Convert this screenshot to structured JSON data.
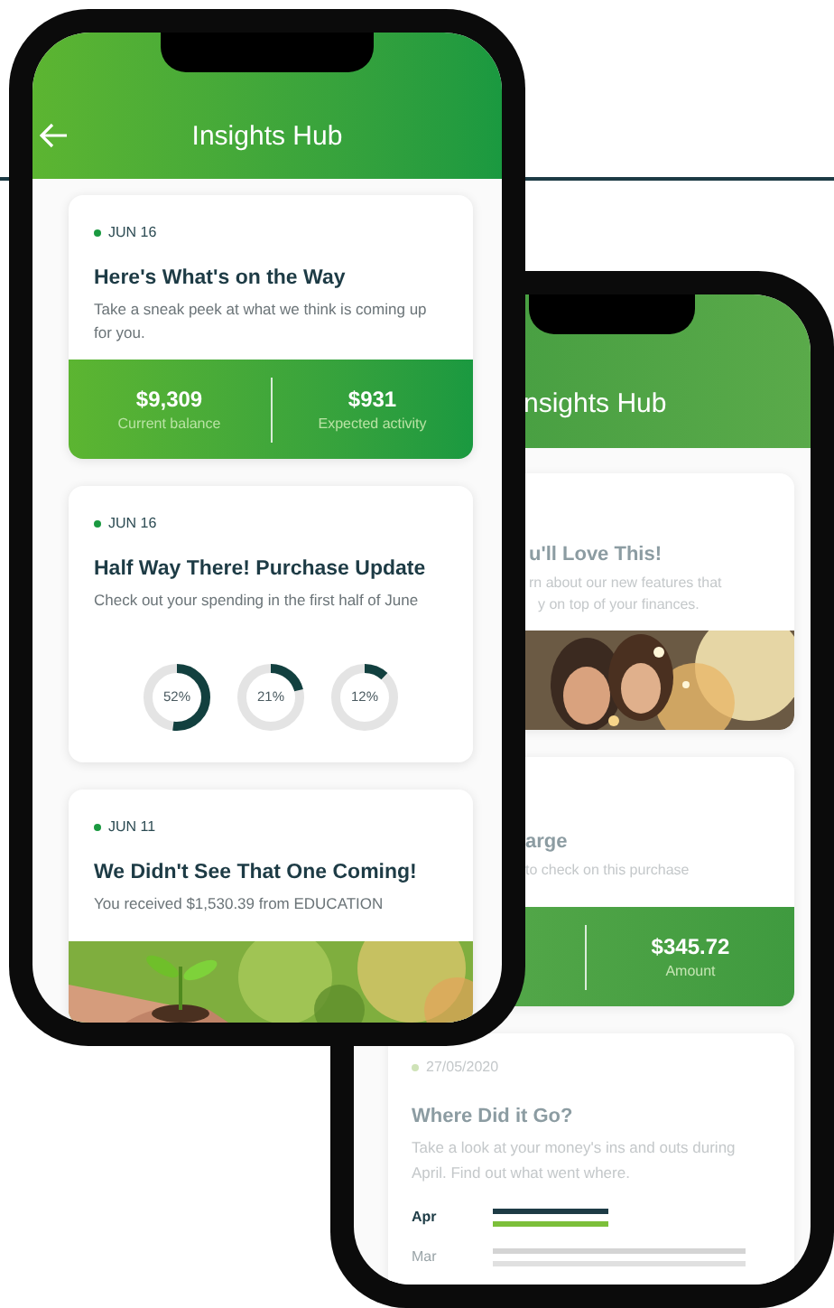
{
  "front_phone": {
    "header": {
      "title": "Insights Hub"
    },
    "cards": [
      {
        "kind": "summary",
        "date": "JUN 16",
        "title": "Here's What's on the Way",
        "description": "Take a sneak peek at what we think is coming up for you.",
        "stats": [
          {
            "value": "$9,309",
            "label": "Current balance"
          },
          {
            "value": "$931",
            "label": "Expected activity"
          }
        ]
      },
      {
        "kind": "rings",
        "date": "JUN 16",
        "title": "Half Way There! Purchase Update",
        "description": "Check out your spending in the first half of June",
        "rings": [
          {
            "label": "52%"
          },
          {
            "label": "21%"
          },
          {
            "label": "12%"
          }
        ]
      },
      {
        "kind": "picture",
        "date": "JUN 11",
        "title": "We Didn't See That One Coming!",
        "description": "You received $1,530.39 from EDUCATION"
      }
    ]
  },
  "back_phone": {
    "header": {
      "title": "nsights Hub"
    },
    "cards": [
      {
        "kind": "picture",
        "title": "u'll Love This!",
        "description_lines": [
          "rn about our new features that",
          "y on top of your finances."
        ]
      },
      {
        "kind": "summary",
        "title": "arge",
        "description": "to check on this purchase",
        "stats": [
          {
            "value": "$345.72",
            "label": "Amount"
          }
        ]
      },
      {
        "kind": "bars",
        "date": "27/05/2020",
        "title": "Where Did it Go?",
        "description": "Take a look at your money's ins and outs during April. Find out what went where.",
        "rows": [
          {
            "label": "Apr",
            "selected": true
          },
          {
            "label": "Mar",
            "selected": false
          }
        ]
      }
    ]
  }
}
